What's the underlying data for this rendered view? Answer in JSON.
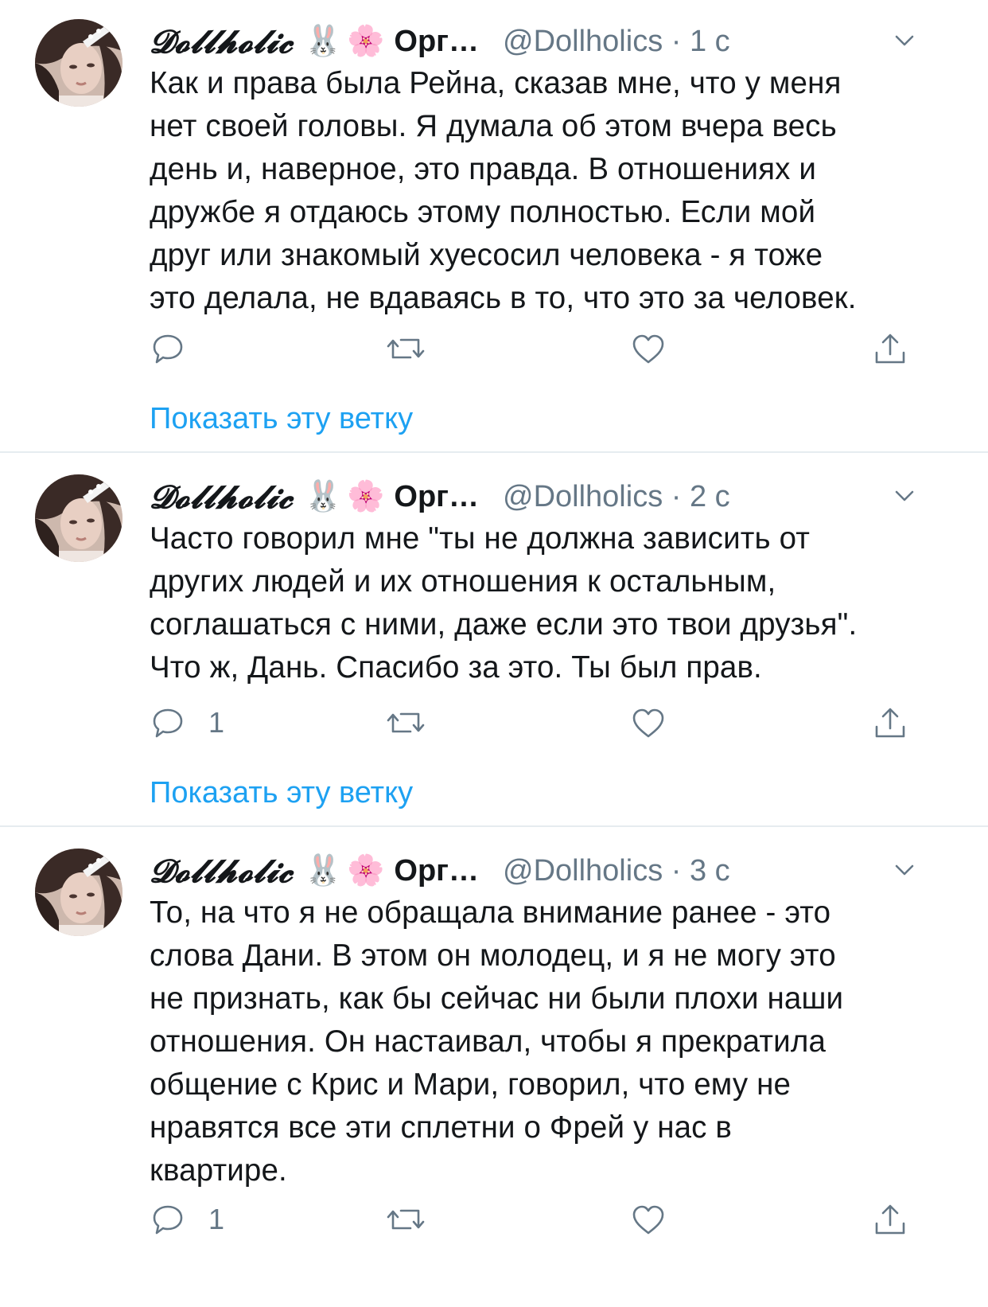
{
  "colors": {
    "accent": "#1da1f2",
    "muted": "#657786",
    "text": "#14171a",
    "divider": "#e6ecf0"
  },
  "tweets": [
    {
      "display_name": "𝓓𝓸𝓵𝓵𝓱𝓸𝓵𝓲𝓬",
      "emoji_1": "🐰",
      "emoji_2": "🌸",
      "org": "Орг…",
      "meta": "@Dollholics · 1 с",
      "text": "Как и права была Рейна, сказав мне, что у меня\nнет своей головы. Я думала об этом вчера весь\nдень и, наверное, это правда. В отношениях и\nдружбе я отдаюсь этому полностью. Если мой\nдруг или знакомый хуесосил человека - я тоже\nэто делала, не вдаваясь в то, что это за человек.",
      "reply_count": "",
      "thread_link": "Показать эту ветку"
    },
    {
      "display_name": "𝓓𝓸𝓵𝓵𝓱𝓸𝓵𝓲𝓬",
      "emoji_1": "🐰",
      "emoji_2": "🌸",
      "org": "Орг…",
      "meta": "@Dollholics · 2 с",
      "text": "Часто говорил мне \"ты не должна зависить от\nдругих людей и их отношения к остальным,\nсоглашаться с ними, даже если это твои друзья\".\nЧто ж, Дань. Спасибо за это. Ты был прав.",
      "reply_count": "1",
      "thread_link": "Показать эту ветку"
    },
    {
      "display_name": "𝓓𝓸𝓵𝓵𝓱𝓸𝓵𝓲𝓬",
      "emoji_1": "🐰",
      "emoji_2": "🌸",
      "org": "Орг…",
      "meta": "@Dollholics · 3 с",
      "text": "То, на что я не обращала внимание ранее - это\nслова Дани. В этом он молодец, и я не могу это\nне признать, как бы сейчас ни были плохи наши\nотношения. Он настаивал, чтобы я прекратила\nобщение с Крис и Мари, говорил, что ему не\nнравятся все эти сплетни о Фрей у нас в\nквартире.",
      "reply_count": "1"
    }
  ]
}
